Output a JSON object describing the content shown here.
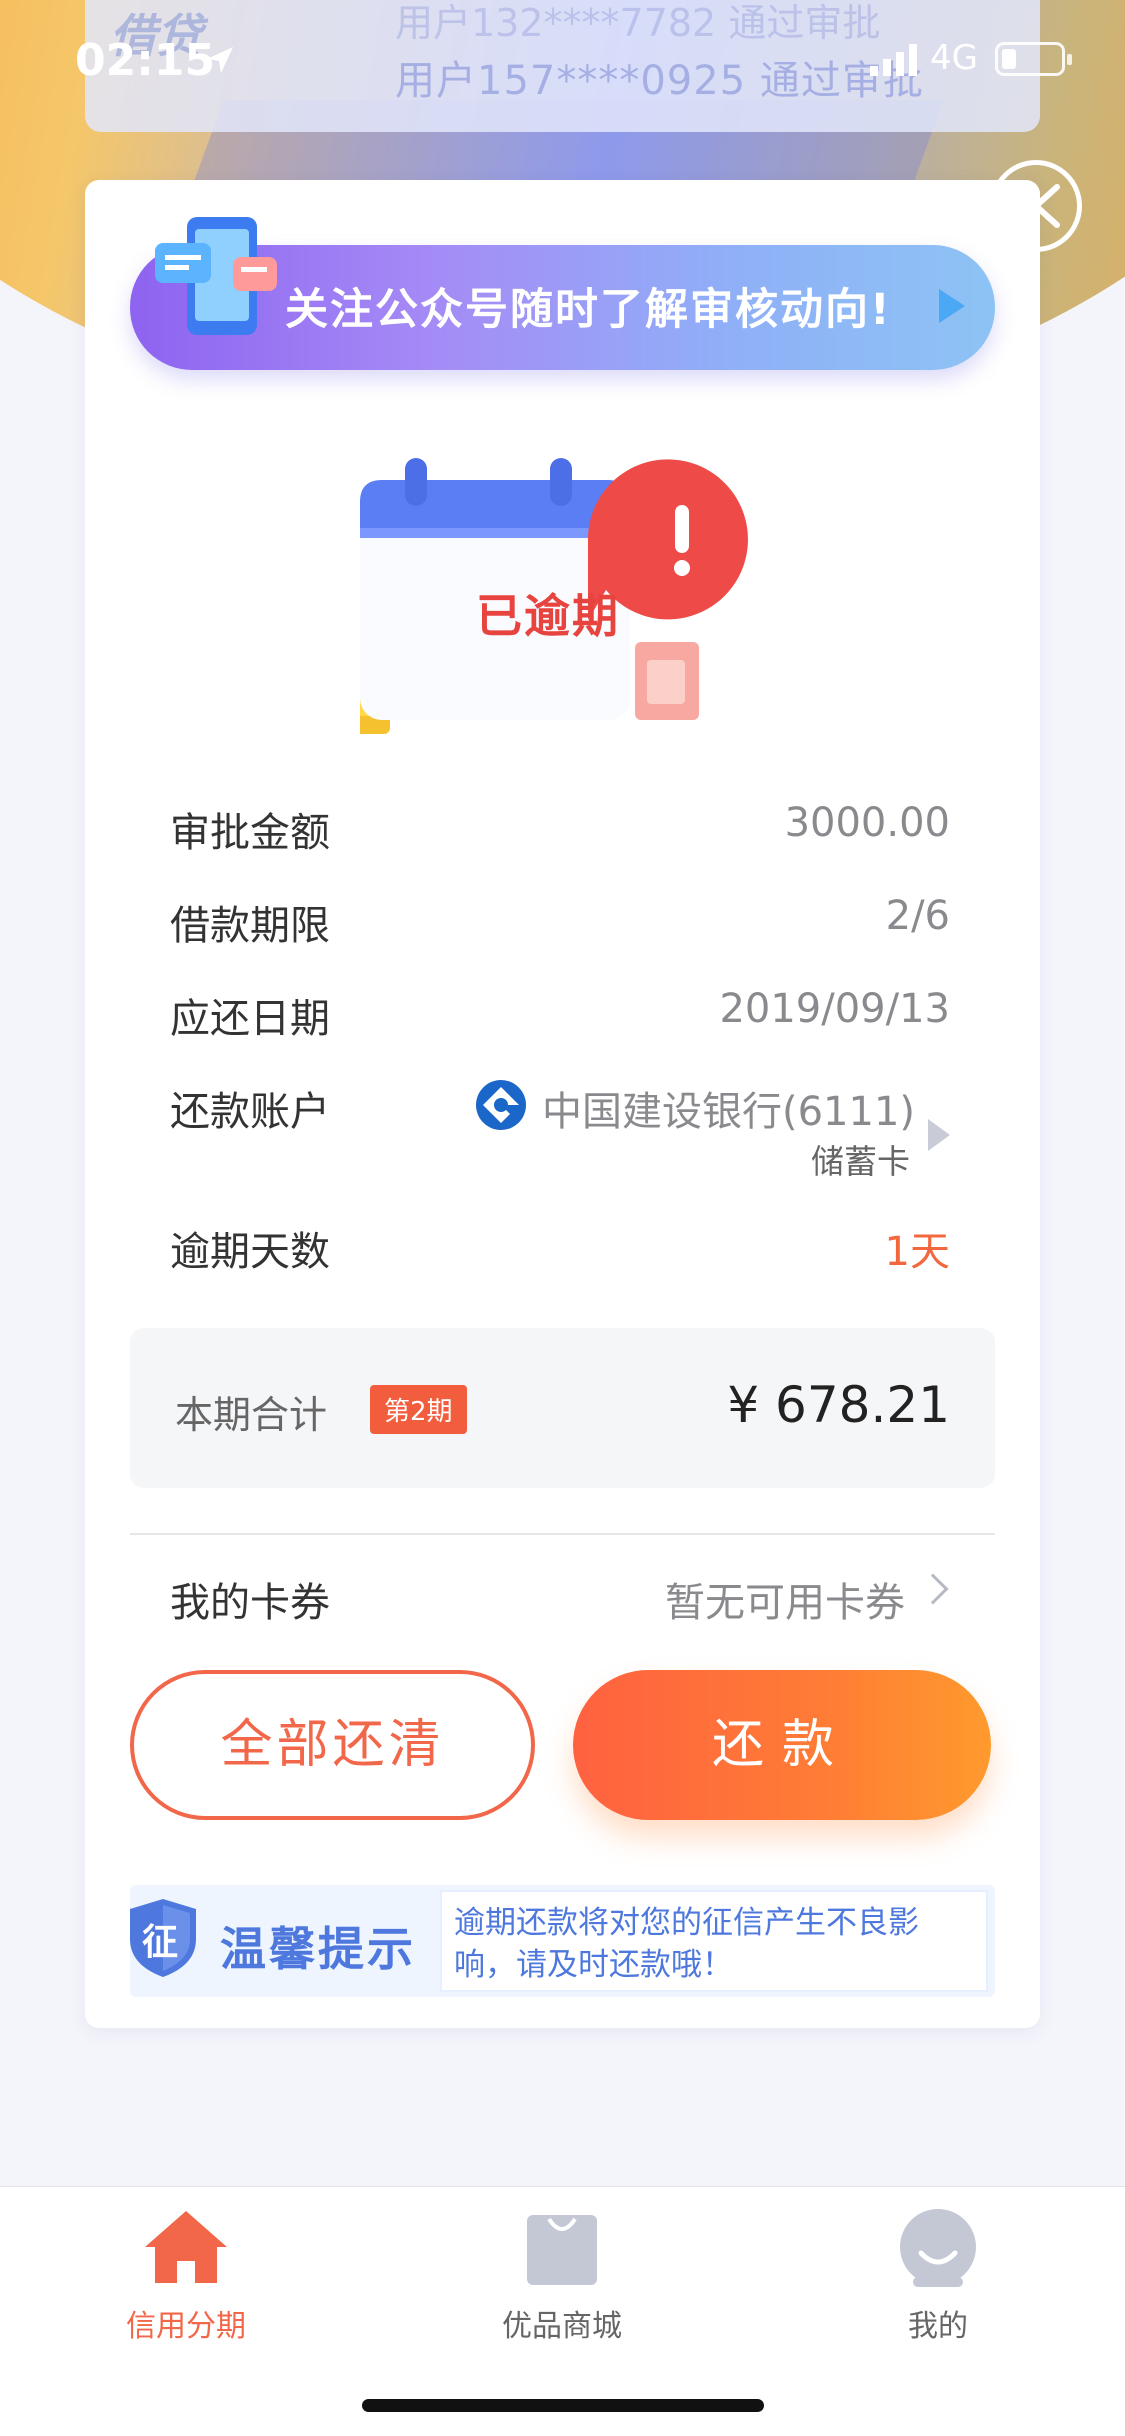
{
  "status_bar": {
    "time": "02:15",
    "network": "4G"
  },
  "notice": {
    "line_prev": "用户132****7782 通过审批",
    "line_current": "用户157****0925 通过审批",
    "logo": "借贷"
  },
  "banner": {
    "text": "关注公众号随时了解审核动向!"
  },
  "status_illustration": {
    "text": "已逾期"
  },
  "details": {
    "approval_amount": {
      "label": "审批金额",
      "value": "3000.00"
    },
    "loan_term": {
      "label": "借款期限",
      "value": "2/6"
    },
    "due_date": {
      "label": "应还日期",
      "value": "2019/09/13"
    },
    "account": {
      "label": "还款账户",
      "bank": "中国建设银行(6111)",
      "card_type": "储蓄卡"
    },
    "overdue_days": {
      "label": "逾期天数",
      "value": "1天"
    }
  },
  "total": {
    "label": "本期合计",
    "period_badge": "第2期",
    "amount": "¥ 678.21"
  },
  "coupon": {
    "label": "我的卡券",
    "value": "暂无可用卡券"
  },
  "buttons": {
    "pay_all": "全部还清",
    "repay": "还款"
  },
  "tip": {
    "shield_char": "征",
    "title": "温馨提示",
    "body": "逾期还款将对您的征信产生不良影响，请及时还款哦！"
  },
  "tabbar": {
    "items": [
      {
        "label": "信用分期",
        "active": true
      },
      {
        "label": "优品商城",
        "active": false
      },
      {
        "label": "我的",
        "active": false
      }
    ]
  },
  "colors": {
    "accent": "#f2674a",
    "tip_blue": "#4e78dd",
    "banner_start": "#8e63f0",
    "banner_end": "#8dc3f4"
  }
}
